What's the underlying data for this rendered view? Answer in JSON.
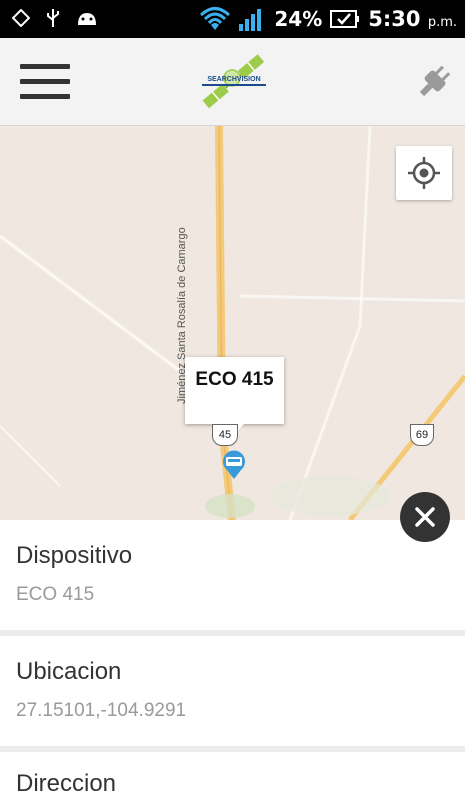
{
  "status_bar": {
    "battery_percent": "24%",
    "time": "5:30",
    "ampm": "p.m."
  },
  "app_bar": {
    "menu_icon": "hamburger-menu-icon",
    "logo_text": "SEARCHVISION",
    "connection_icon": "plug-disconnected-icon"
  },
  "map": {
    "device_label": "ECO 415",
    "road_name": "Jiménez Santa Rosalía de Camargo",
    "route_shield_1": "45",
    "route_shield_2": "69",
    "locate_icon": "gps-locate-icon",
    "colors": {
      "land": "#f0e8e0",
      "highway": "#f4c977",
      "marker": "#3a9ad9"
    }
  },
  "details": {
    "close_icon": "close-icon",
    "fields": [
      {
        "label": "Dispositivo",
        "value": "ECO 415"
      },
      {
        "label": "Ubicacion",
        "value": "27.15101,-104.9291"
      },
      {
        "label": "Direccion",
        "value": ""
      }
    ]
  }
}
